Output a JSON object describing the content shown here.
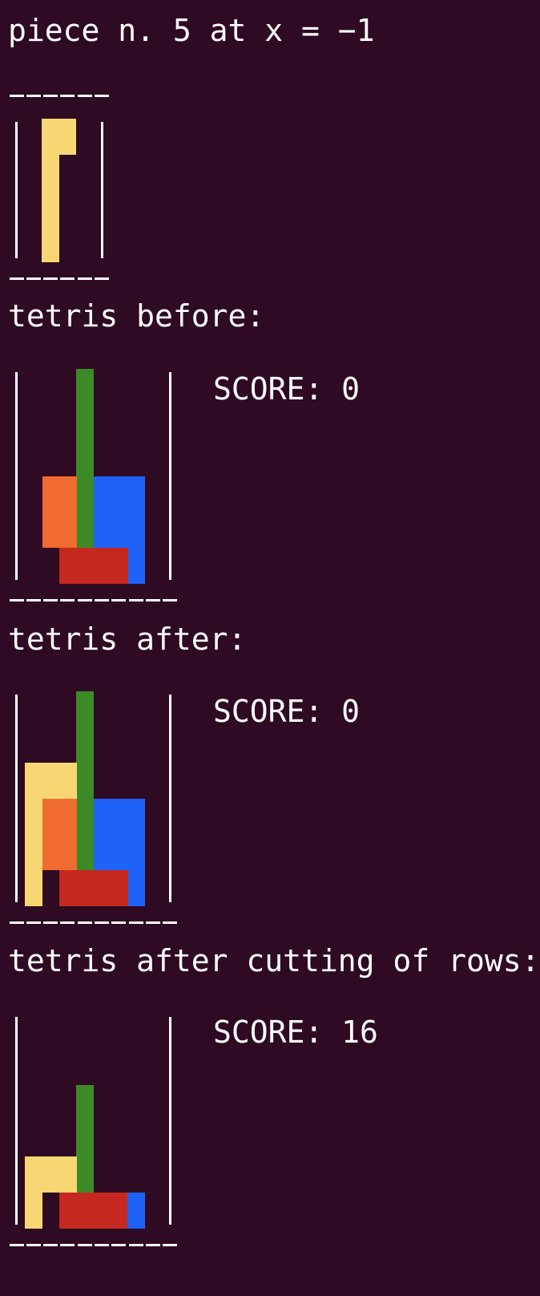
{
  "colors": {
    "background": "#2f0a23",
    "text": "#ffffff",
    "yellow": "#f7d774",
    "green": "#3c8a27",
    "orange": "#ef6b30",
    "blue": "#1f62f7",
    "red": "#c4281e"
  },
  "header": {
    "text": "piece n. 5 at x = −1"
  },
  "piece": {
    "cols": 4,
    "rows": 4,
    "bottom_dashes": "——————",
    "cells": [
      {
        "c": 1,
        "r": 0,
        "color": "yellow"
      },
      {
        "c": 2,
        "r": 0,
        "color": "yellow"
      },
      {
        "c": 1,
        "r": 1,
        "color": "yellow"
      },
      {
        "c": 1,
        "r": 2,
        "color": "yellow"
      },
      {
        "c": 1,
        "r": 3,
        "color": "yellow"
      }
    ]
  },
  "sections": [
    {
      "title": "tetris before:",
      "score_label": "SCORE: 0",
      "cols": 8,
      "rows": 6,
      "cells": [
        {
          "c": 4,
          "r": 0,
          "color": "green"
        },
        {
          "c": 4,
          "r": 1,
          "color": "green"
        },
        {
          "c": 4,
          "r": 2,
          "color": "green"
        },
        {
          "c": 4,
          "r": 3,
          "color": "green"
        },
        {
          "c": 4,
          "r": 4,
          "color": "green"
        },
        {
          "c": 2,
          "r": 3,
          "color": "orange"
        },
        {
          "c": 3,
          "r": 3,
          "color": "orange"
        },
        {
          "c": 2,
          "r": 4,
          "color": "orange"
        },
        {
          "c": 3,
          "r": 4,
          "color": "orange"
        },
        {
          "c": 5,
          "r": 3,
          "color": "blue"
        },
        {
          "c": 6,
          "r": 3,
          "color": "blue"
        },
        {
          "c": 7,
          "r": 3,
          "color": "blue"
        },
        {
          "c": 5,
          "r": 4,
          "color": "blue"
        },
        {
          "c": 6,
          "r": 4,
          "color": "blue"
        },
        {
          "c": 7,
          "r": 4,
          "color": "blue"
        },
        {
          "c": 7,
          "r": 5,
          "color": "blue"
        },
        {
          "c": 3,
          "r": 5,
          "color": "red"
        },
        {
          "c": 4,
          "r": 5,
          "color": "red"
        },
        {
          "c": 5,
          "r": 5,
          "color": "red"
        },
        {
          "c": 6,
          "r": 5,
          "color": "red"
        }
      ]
    },
    {
      "title": "tetris after:",
      "score_label": "SCORE: 0",
      "cols": 8,
      "rows": 6,
      "cells": [
        {
          "c": 4,
          "r": 0,
          "color": "green"
        },
        {
          "c": 4,
          "r": 1,
          "color": "green"
        },
        {
          "c": 4,
          "r": 2,
          "color": "green"
        },
        {
          "c": 4,
          "r": 3,
          "color": "green"
        },
        {
          "c": 4,
          "r": 4,
          "color": "green"
        },
        {
          "c": 1,
          "r": 2,
          "color": "yellow"
        },
        {
          "c": 2,
          "r": 2,
          "color": "yellow"
        },
        {
          "c": 3,
          "r": 2,
          "color": "yellow"
        },
        {
          "c": 1,
          "r": 3,
          "color": "yellow"
        },
        {
          "c": 1,
          "r": 4,
          "color": "yellow"
        },
        {
          "c": 1,
          "r": 5,
          "color": "yellow"
        },
        {
          "c": 2,
          "r": 3,
          "color": "orange"
        },
        {
          "c": 3,
          "r": 3,
          "color": "orange"
        },
        {
          "c": 2,
          "r": 4,
          "color": "orange"
        },
        {
          "c": 3,
          "r": 4,
          "color": "orange"
        },
        {
          "c": 5,
          "r": 3,
          "color": "blue"
        },
        {
          "c": 6,
          "r": 3,
          "color": "blue"
        },
        {
          "c": 7,
          "r": 3,
          "color": "blue"
        },
        {
          "c": 5,
          "r": 4,
          "color": "blue"
        },
        {
          "c": 6,
          "r": 4,
          "color": "blue"
        },
        {
          "c": 7,
          "r": 4,
          "color": "blue"
        },
        {
          "c": 7,
          "r": 5,
          "color": "blue"
        },
        {
          "c": 3,
          "r": 5,
          "color": "red"
        },
        {
          "c": 4,
          "r": 5,
          "color": "red"
        },
        {
          "c": 5,
          "r": 5,
          "color": "red"
        },
        {
          "c": 6,
          "r": 5,
          "color": "red"
        }
      ]
    },
    {
      "title": "tetris after cutting of rows:",
      "score_label": "SCORE: 16",
      "cols": 8,
      "rows": 6,
      "cells": [
        {
          "c": 4,
          "r": 2,
          "color": "green"
        },
        {
          "c": 4,
          "r": 3,
          "color": "green"
        },
        {
          "c": 4,
          "r": 4,
          "color": "green"
        },
        {
          "c": 1,
          "r": 4,
          "color": "yellow"
        },
        {
          "c": 2,
          "r": 4,
          "color": "yellow"
        },
        {
          "c": 3,
          "r": 4,
          "color": "yellow"
        },
        {
          "c": 1,
          "r": 5,
          "color": "yellow"
        },
        {
          "c": 3,
          "r": 5,
          "color": "red"
        },
        {
          "c": 4,
          "r": 5,
          "color": "red"
        },
        {
          "c": 5,
          "r": 5,
          "color": "red"
        },
        {
          "c": 6,
          "r": 5,
          "color": "red"
        },
        {
          "c": 7,
          "r": 5,
          "color": "blue"
        }
      ]
    }
  ]
}
